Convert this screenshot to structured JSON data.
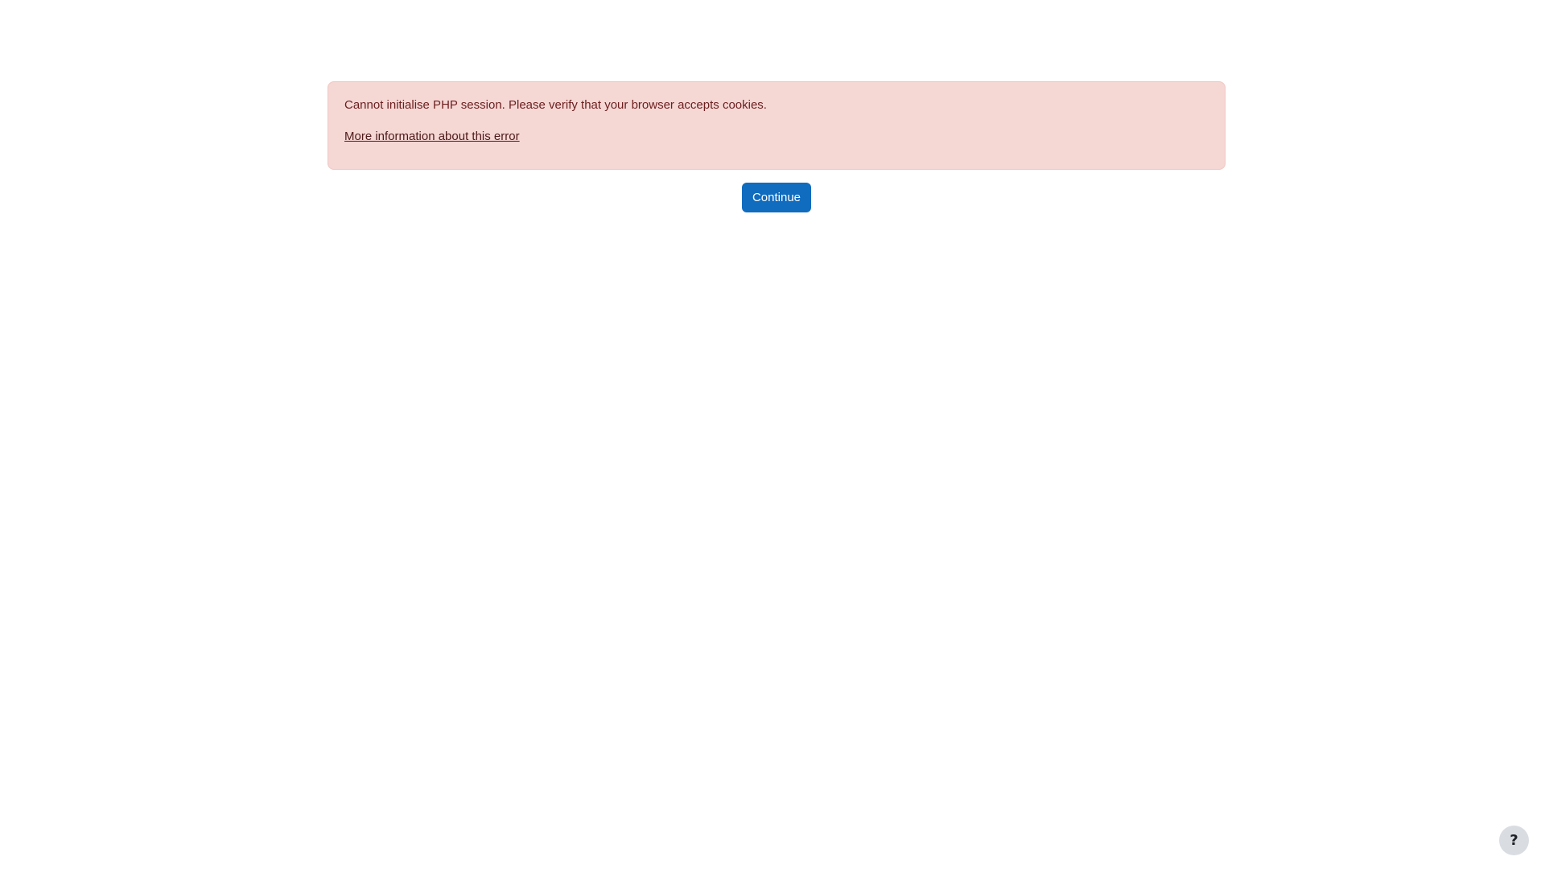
{
  "alert": {
    "message": "Cannot initialise PHP session. Please verify that your browser accepts cookies.",
    "link_text": "More information about this error"
  },
  "actions": {
    "continue_label": "Continue"
  },
  "help": {
    "icon_name": "question-mark-icon",
    "label": "?"
  },
  "colors": {
    "alert_background": "#f5d7d4",
    "alert_text": "#6b1f1f",
    "primary_button": "#0f6cbf",
    "help_button": "#d9dde2"
  }
}
